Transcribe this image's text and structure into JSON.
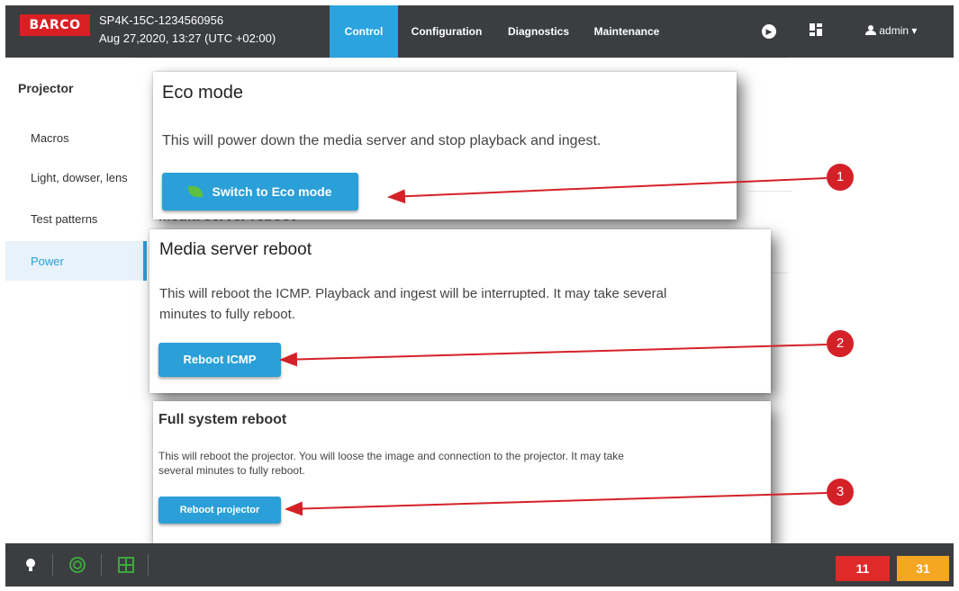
{
  "header": {
    "logo": "BARCO",
    "device_name": "SP4K-15C-1234560956",
    "datetime": "Aug 27,2020, 13:27 (UTC +02:00)",
    "tabs": [
      {
        "label": "Control",
        "active": true
      },
      {
        "label": "Configuration",
        "active": false
      },
      {
        "label": "Diagnostics",
        "active": false
      },
      {
        "label": "Maintenance",
        "active": false
      }
    ],
    "user": "admin",
    "user_caret": "▾",
    "icons": [
      "play-icon",
      "dashboard-icon",
      "user-icon"
    ]
  },
  "sidebar": {
    "title": "Projector",
    "items": [
      {
        "label": "Macros"
      },
      {
        "label": "Light, dowser, lens"
      },
      {
        "label": "Test patterns"
      },
      {
        "label": "Power",
        "active": true
      }
    ]
  },
  "background": {
    "peek_heading": "Media server reboot"
  },
  "panels": {
    "eco": {
      "title": "Eco mode",
      "text": "This will power down the media server and stop playback and ingest.",
      "button": "Switch to Eco mode"
    },
    "media": {
      "title": "Media server reboot",
      "text_line1": "This will reboot the ICMP. Playback and ingest will be interrupted. It may take several",
      "text_line2": "minutes to fully reboot.",
      "button": "Reboot ICMP"
    },
    "full": {
      "title": "Full system reboot",
      "text_line1": "This will reboot the projector. You will loose the image and connection to the projector. It may take",
      "text_line2": "several minutes to fully reboot.",
      "button": "Reboot projector"
    }
  },
  "callouts": [
    "1",
    "2",
    "3"
  ],
  "statusbar": {
    "icons": [
      "lightbulb-icon",
      "target-icon",
      "grid-icon"
    ],
    "error_count": "11",
    "warning_count": "31",
    "colors": {
      "error": "#e02a2a",
      "warning": "#f5a623",
      "ok": "#3ea63e"
    }
  },
  "colors": {
    "accent": "#2aa3e0",
    "header_bg": "#3b3d40",
    "callout": "#d42128"
  }
}
